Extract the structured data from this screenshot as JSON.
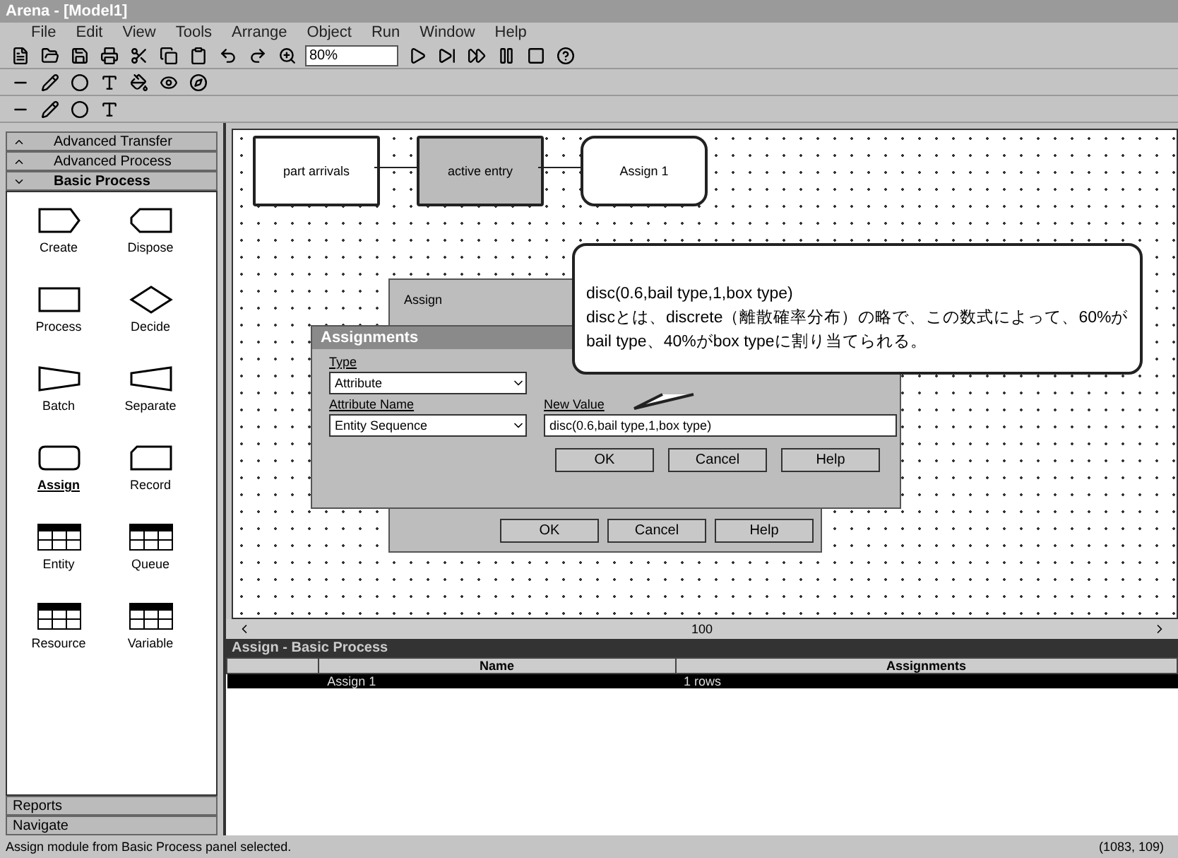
{
  "window": {
    "title": "Arena - [Model1]"
  },
  "menu": [
    "File",
    "Edit",
    "View",
    "Tools",
    "Arrange",
    "Object",
    "Run",
    "Window",
    "Help"
  ],
  "zoom_field": {
    "value": "80%"
  },
  "panels": [
    {
      "label": "Advanced Transfer",
      "expanded": false
    },
    {
      "label": "Advanced Process",
      "expanded": false
    },
    {
      "label": "Basic Process",
      "expanded": true
    }
  ],
  "modules": [
    {
      "label": "Create",
      "kind": "create",
      "selected": false
    },
    {
      "label": "Dispose",
      "kind": "dispose",
      "selected": false
    },
    {
      "label": "Process",
      "kind": "process",
      "selected": false
    },
    {
      "label": "Decide",
      "kind": "decide",
      "selected": false
    },
    {
      "label": "Batch",
      "kind": "batch",
      "selected": false
    },
    {
      "label": "Separate",
      "kind": "separate",
      "selected": false
    },
    {
      "label": "Assign",
      "kind": "assign",
      "selected": true
    },
    {
      "label": "Record",
      "kind": "record",
      "selected": false
    },
    {
      "label": "Entity",
      "kind": "sheet",
      "selected": false
    },
    {
      "label": "Queue",
      "kind": "sheet",
      "selected": false
    },
    {
      "label": "Resource",
      "kind": "sheet",
      "selected": false
    },
    {
      "label": "Variable",
      "kind": "sheet",
      "selected": false
    }
  ],
  "bottom_panels": [
    {
      "label": "Reports"
    },
    {
      "label": "Navigate"
    }
  ],
  "flowchart": [
    {
      "label": "part arrivals",
      "kind": "create"
    },
    {
      "label": "active entry",
      "kind": "process"
    },
    {
      "label": "Assign 1",
      "kind": "assign"
    }
  ],
  "assign_dialog": {
    "name": "Assign",
    "buttons": [
      "OK",
      "Cancel",
      "Help"
    ]
  },
  "assignments_dialog": {
    "title": "Assignments",
    "type_label": "Type",
    "type_value": "Attribute",
    "attribute_label": "Attribute Name",
    "attribute_value": "Entity Sequence",
    "new_value_label": "New Value",
    "new_value": "disc(0.6,bail type,1,box type)",
    "buttons": [
      "OK",
      "Cancel",
      "Help"
    ]
  },
  "callout": {
    "lines": [
      "disc(0.6,bail type,1,box type)",
      "discとは、discrete（離散確率分布）の略で、この数式によって、60%がbail type、40%がbox typeに割り当てられる。"
    ]
  },
  "scroll_label": "100",
  "data_table": {
    "title": "Assign - Basic Process",
    "columns": [
      "Name",
      "Assignments"
    ],
    "rows": [
      {
        "cells": [
          "Assign 1",
          "1 rows"
        ],
        "selected": true
      }
    ]
  },
  "status_bar": {
    "message": "Assign module from Basic Process panel selected.",
    "coords": "(1083, 109)"
  }
}
